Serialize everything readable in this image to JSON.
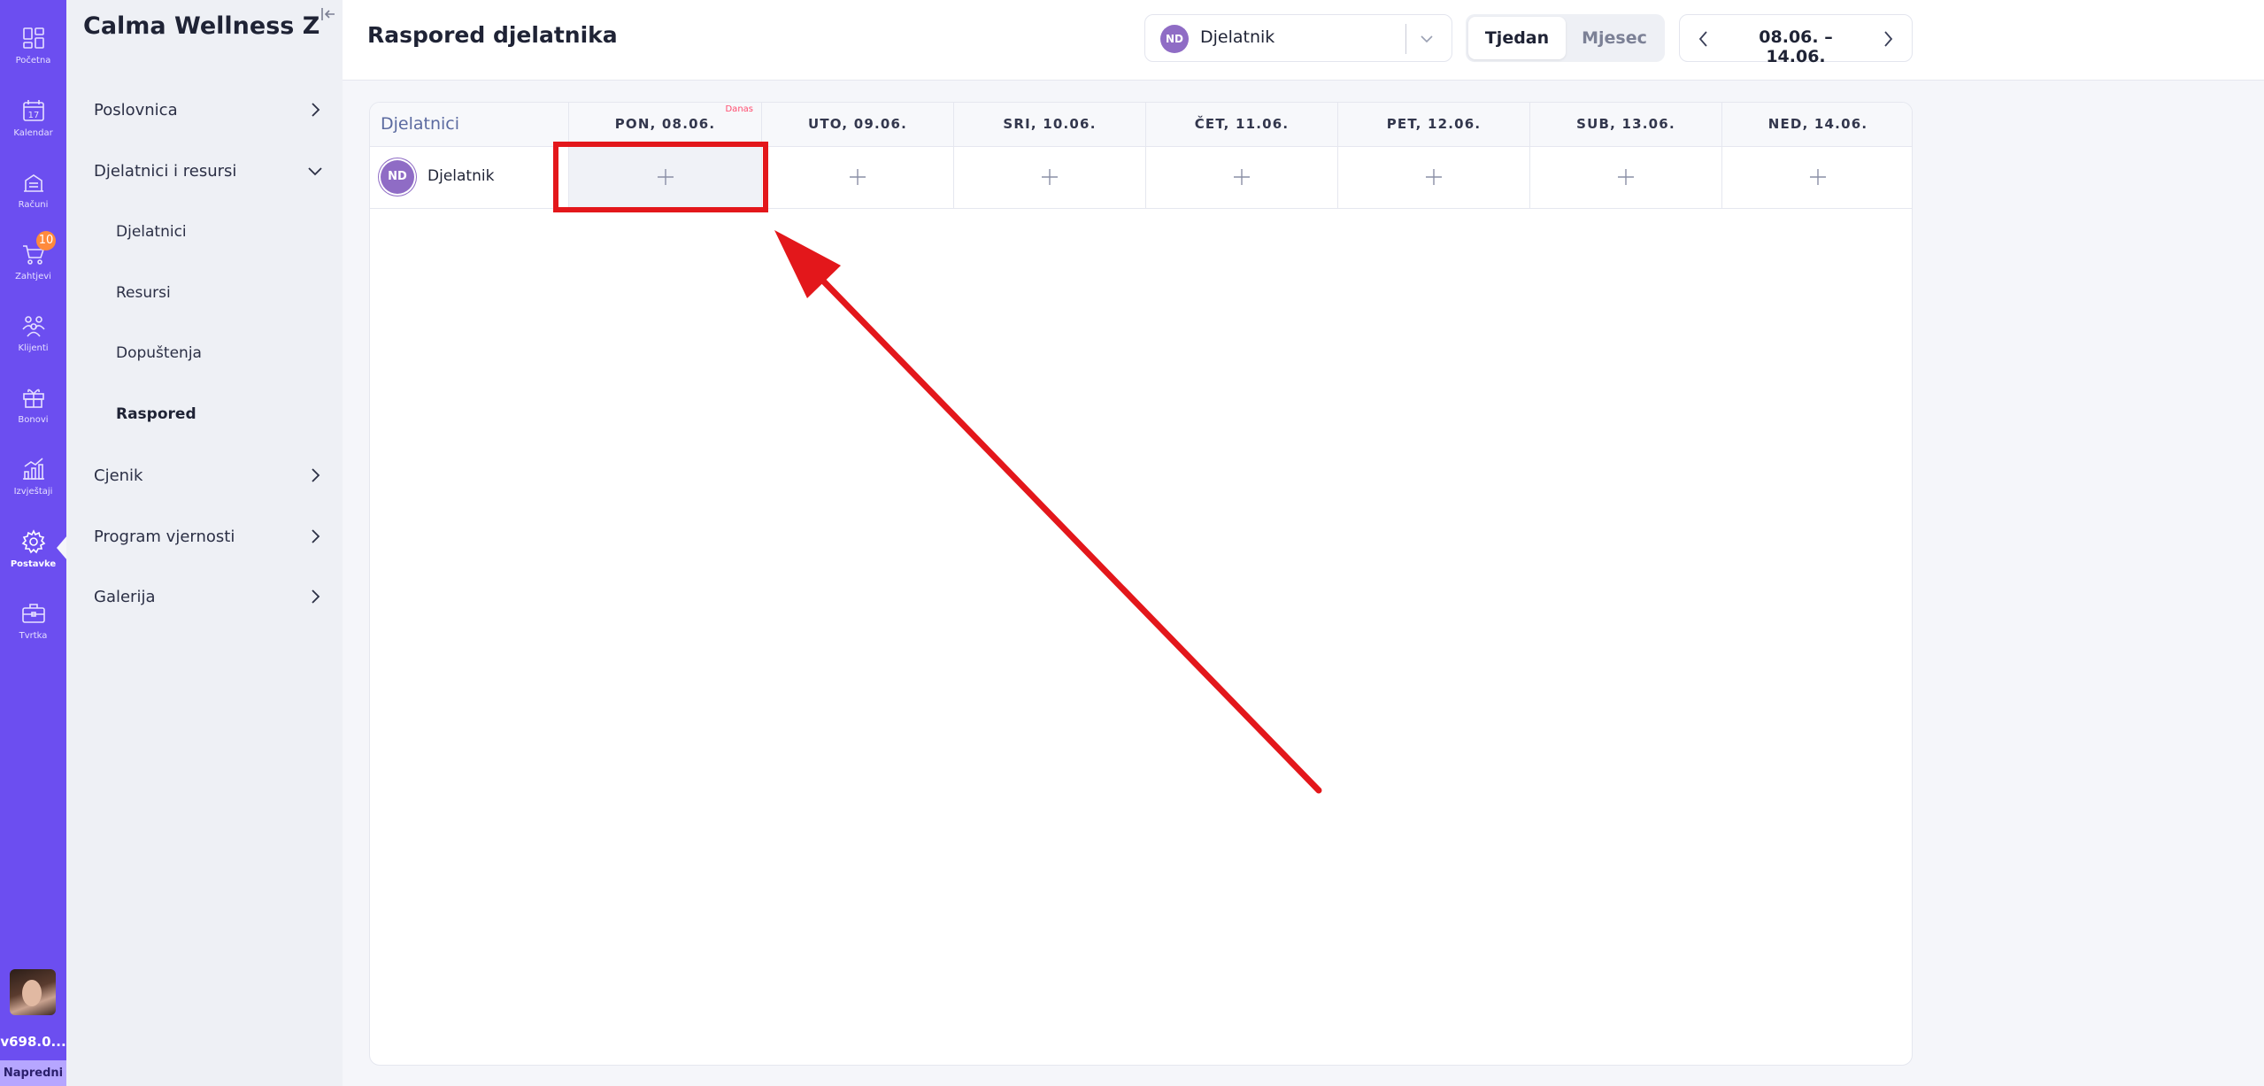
{
  "rail": {
    "items": [
      {
        "label": "Početna",
        "icon": "dashboard-icon"
      },
      {
        "label": "Kalendar",
        "icon": "calendar-icon",
        "day": "17"
      },
      {
        "label": "Računi",
        "icon": "receipt-icon"
      },
      {
        "label": "Zahtjevi",
        "icon": "cart-icon",
        "badge": "10"
      },
      {
        "label": "Klijenti",
        "icon": "clients-icon"
      },
      {
        "label": "Bonovi",
        "icon": "gift-icon"
      },
      {
        "label": "Izvještaji",
        "icon": "reports-icon"
      },
      {
        "label": "Postavke",
        "icon": "gear-icon",
        "active": true
      },
      {
        "label": "Tvrtka",
        "icon": "briefcase-icon"
      }
    ],
    "version": "v698.0...",
    "plan": "Napredni"
  },
  "sidebar": {
    "company": "Calma Wellness Z...",
    "sections": [
      {
        "label": "Poslovnica"
      },
      {
        "label": "Djelatnici i resursi",
        "expanded": true,
        "children": [
          "Djelatnici",
          "Resursi",
          "Dopuštenja",
          "Raspored"
        ],
        "active_child": "Raspored"
      },
      {
        "label": "Cjenik"
      },
      {
        "label": "Program vjernosti"
      },
      {
        "label": "Galerija"
      }
    ]
  },
  "header": {
    "title": "Raspored djelatnika",
    "employee_select": {
      "initials": "ND",
      "name": "Djelatnik"
    },
    "view_toggle": {
      "active": "Tjedan",
      "inactive": "Mjesec"
    },
    "date_range": "08.06. – 14.06."
  },
  "schedule": {
    "first_column": "Djelatnici",
    "today_label": "Danas",
    "days": [
      "PON, 08.06.",
      "UTO, 09.06.",
      "SRI, 10.06.",
      "ČET, 11.06.",
      "PET, 12.06.",
      "SUB, 13.06.",
      "NED, 14.06."
    ],
    "today_index": 0,
    "employees": [
      {
        "initials": "ND",
        "name": "Djelatnik"
      }
    ]
  },
  "colors": {
    "rail": "#6c4ef0",
    "badge": "#ff8a3d",
    "avatar": "#8f6cc5",
    "annotation": "#e3171b",
    "today_tag": "#ff4b6e"
  }
}
